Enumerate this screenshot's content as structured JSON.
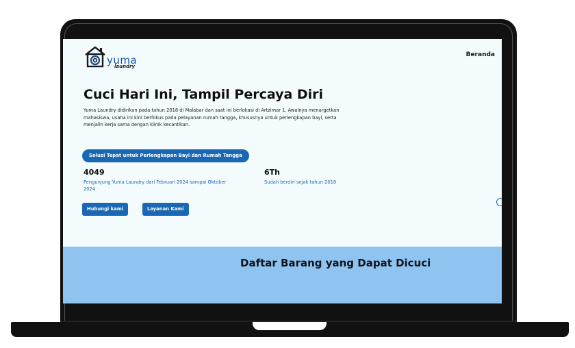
{
  "brand": {
    "name": "yuma",
    "sub": "laundry",
    "color": "#1b4f9c"
  },
  "nav": {
    "home": "Beranda"
  },
  "hero": {
    "title": "Cuci Hari Ini, Tampil Percaya Diri",
    "description": "Yuma Laundry didirikan pada tahun 2018 di Malabar dan saat ini berlokasi di Artzimar 1. Awalnya menargetkan mahasiswa, usaha ini kini berfokus pada pelayanan rumah tangga, khususnya untuk perlengkapan bayi, serta menjalin kerja sama dengan klinik kecantikan.",
    "badge": "Solusi Tepat untuk Perlengkapan Bayi dan Rumah Tangga"
  },
  "stats": [
    {
      "value": "4049",
      "label": "Pengunjung Yuma Laundry dari Februari 2024 sampai Oktober 2024"
    },
    {
      "value": "6Th",
      "label": "Sudah berdiri sejak tahun 2018"
    }
  ],
  "cta": {
    "contact": "Hubungi kami",
    "services": "Layanan Kami"
  },
  "items_section": {
    "title": "Daftar Barang yang Dapat Dicuci"
  },
  "colors": {
    "accent": "#1a68b3",
    "band": "#8fc4f1",
    "screen_bg": "#f3fbfd"
  },
  "icons": {
    "logo": "washing-machine-house-icon",
    "edge": "circle-icon"
  }
}
